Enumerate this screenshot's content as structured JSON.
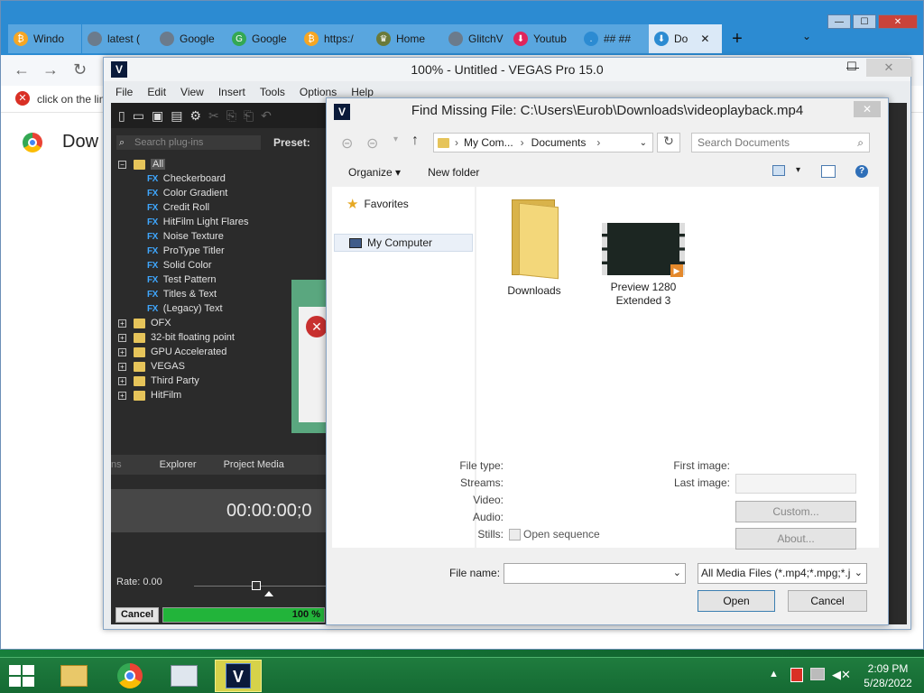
{
  "browser": {
    "tabs": [
      {
        "label": "Windo",
        "fav_color": "#f6a623",
        "fav_glyph": "₿"
      },
      {
        "label": "latest (",
        "fav_color": "#6b7b8c",
        "fav_glyph": ""
      },
      {
        "label": "Google",
        "fav_color": "#6b7b8c",
        "fav_glyph": ""
      },
      {
        "label": "Google",
        "fav_color": "#34a853",
        "fav_glyph": "G"
      },
      {
        "label": "https:/",
        "fav_color": "#f6a623",
        "fav_glyph": "₿"
      },
      {
        "label": "Home",
        "fav_color": "#6a7a3a",
        "fav_glyph": "♛"
      },
      {
        "label": "GlitchV",
        "fav_color": "#6b7b8c",
        "fav_glyph": ""
      },
      {
        "label": "Youtub",
        "fav_color": "#e0255b",
        "fav_glyph": "⬇"
      },
      {
        "label": "## ##",
        "fav_color": "#2c8bd2",
        "fav_glyph": "."
      },
      {
        "label": "Do",
        "fav_color": "#2c8bd2",
        "fav_glyph": "⬇",
        "close": "✕"
      }
    ],
    "new_tab": "+",
    "tab_menu": "⌄",
    "window_buttons": {
      "minimize": "—",
      "maximize": "☐",
      "close": "✕"
    },
    "nav": {
      "back": "←",
      "forward": "→",
      "reload": "↻"
    },
    "infobar_text": "click on the lin",
    "page_heading": "Dow"
  },
  "vegas": {
    "title": "100% - Untitled - VEGAS Pro 15.0",
    "logo": "V",
    "menu": [
      "File",
      "Edit",
      "View",
      "Insert",
      "Tools",
      "Options",
      "Help"
    ],
    "search_placeholder": "Search plug-ins",
    "preset_label": "Preset:",
    "tree": {
      "root": "All",
      "fx_items": [
        "Checkerboard",
        "Color Gradient",
        "Credit Roll",
        "HitFilm Light Flares",
        "Noise Texture",
        "ProType Titler",
        "Solid Color",
        "Test Pattern",
        "Titles & Text",
        "(Legacy) Text"
      ],
      "folders": [
        "OFX",
        "32-bit floating point",
        "GPU Accelerated",
        "VEGAS",
        "Third Party",
        "HitFilm"
      ]
    },
    "fx_badge": "FX",
    "tabs": [
      "ns",
      "Explorer",
      "Project Media"
    ],
    "timecode": "00:00:00;0",
    "rate": "Rate: 0.00",
    "cancel": "Cancel",
    "progress_pct": 100,
    "progress_label": "100 %"
  },
  "dialog": {
    "title": "Find Missing File: C:\\Users\\Eurob\\Downloads\\videoplayback.mp4",
    "breadcrumb": [
      "My Com...",
      "Documents"
    ],
    "search_placeholder": "Search Documents",
    "organize": "Organize ▾",
    "new_folder": "New folder",
    "nav_items": [
      {
        "label": "Favorites",
        "icon": "star-icon"
      },
      {
        "label": "My Computer",
        "icon": "computer-icon"
      }
    ],
    "files": [
      {
        "label": "Downloads",
        "type": "folder"
      },
      {
        "label": "Preview 1280 Extended 3",
        "type": "video"
      }
    ],
    "details": {
      "file_type": "File type:",
      "streams": "Streams:",
      "video": "Video:",
      "audio": "Audio:",
      "stills": "Stills:",
      "open_sequence": "Open sequence",
      "first_image": "First image:",
      "last_image": "Last image:",
      "custom": "Custom...",
      "about": "About..."
    },
    "file_name_label": "File name:",
    "file_name_value": "",
    "filter": "All Media Files (*.mp4;*.mpg;*.j",
    "open": "Open",
    "cancel": "Cancel",
    "close": "✕"
  },
  "taskbar": {
    "clock_time": "2:09 PM",
    "clock_date": "5/28/2022",
    "items": [
      "file-explorer-icon",
      "chrome-icon",
      "task-manager-icon",
      "vegas-icon"
    ]
  }
}
